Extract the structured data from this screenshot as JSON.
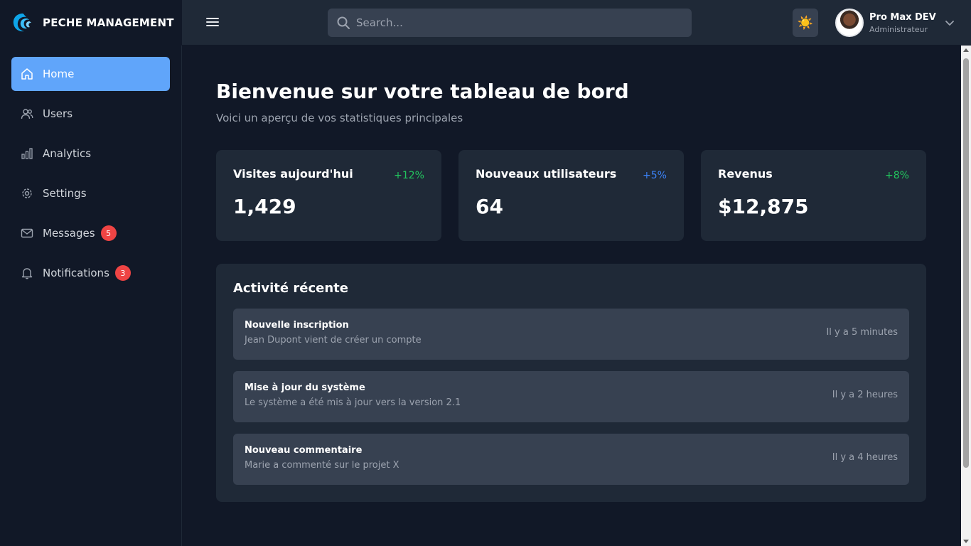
{
  "brand": {
    "name": "PECHE MANAGEMENT",
    "logo_icon": "wave-logo-icon"
  },
  "header": {
    "search_placeholder": "Search...",
    "theme_icon": "☀️",
    "user": {
      "name": "Pro Max DEV",
      "role": "Administrateur"
    }
  },
  "sidebar": {
    "items": [
      {
        "label": "Home",
        "icon": "home-icon",
        "active": true
      },
      {
        "label": "Users",
        "icon": "users-icon"
      },
      {
        "label": "Analytics",
        "icon": "bar-chart-icon"
      },
      {
        "label": "Settings",
        "icon": "gear-icon"
      },
      {
        "label": "Messages",
        "icon": "mail-icon",
        "badge": "5"
      },
      {
        "label": "Notifications",
        "icon": "bell-icon",
        "badge": "3"
      }
    ]
  },
  "main": {
    "title": "Bienvenue sur votre tableau de bord",
    "subtitle": "Voici un aperçu de vos statistiques principales",
    "stats": [
      {
        "label": "Visites aujourd'hui",
        "delta": "+12%",
        "delta_color": "#22c55e",
        "value": "1,429"
      },
      {
        "label": "Nouveaux utilisateurs",
        "delta": "+5%",
        "delta_color": "#3b82f6",
        "value": "64"
      },
      {
        "label": "Revenus",
        "delta": "+8%",
        "delta_color": "#22c55e",
        "value": "$12,875"
      }
    ],
    "activity": {
      "title": "Activité récente",
      "items": [
        {
          "title": "Nouvelle inscription",
          "desc": "Jean Dupont vient de créer un compte",
          "time": "Il y a 5 minutes"
        },
        {
          "title": "Mise à jour du système",
          "desc": "Le système a été mis à jour vers la version 2.1",
          "time": "Il y a 2 heures"
        },
        {
          "title": "Nouveau commentaire",
          "desc": "Marie a commenté sur le projet X",
          "time": "Il y a 4 heures"
        }
      ]
    }
  },
  "colors": {
    "accent": "#60a5fa",
    "badge": "#ef4444",
    "bg": "#111827",
    "card": "#1f2937"
  }
}
